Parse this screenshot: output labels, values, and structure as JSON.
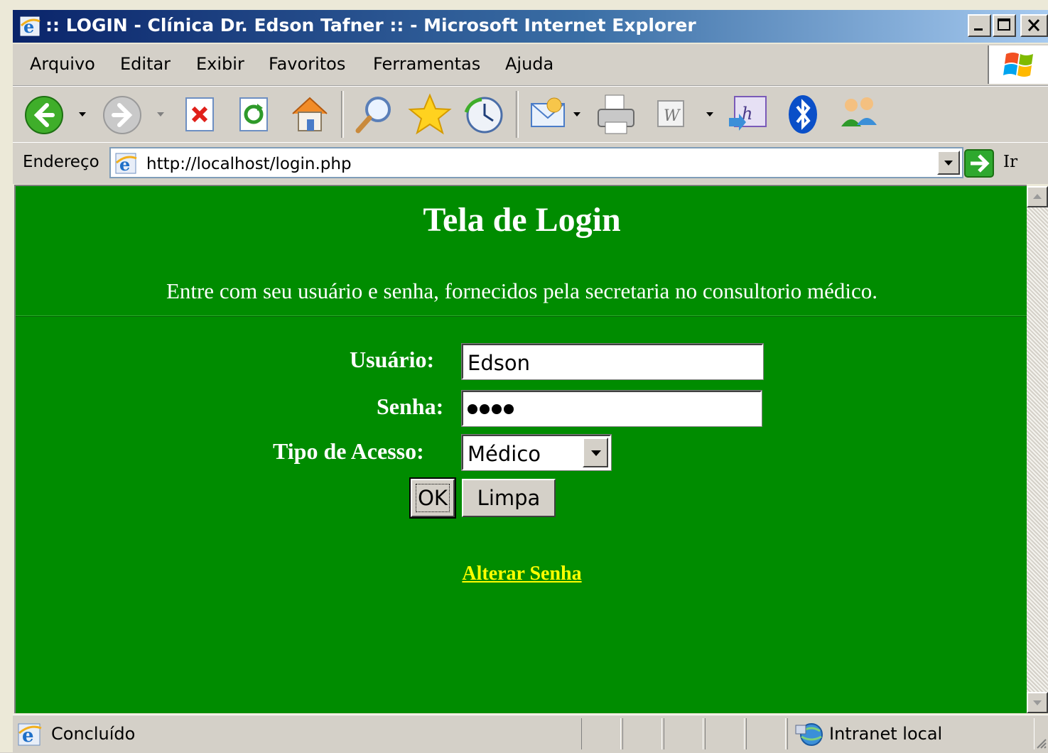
{
  "window": {
    "title": ":: LOGIN - Clínica Dr. Edson Tafner :: - Microsoft Internet Explorer"
  },
  "menu": {
    "items": [
      "Arquivo",
      "Editar",
      "Exibir",
      "Favoritos",
      "Ferramentas",
      "Ajuda"
    ]
  },
  "toolbar": {
    "buttons": [
      "back-icon",
      "forward-icon",
      "stop-icon",
      "refresh-icon",
      "home-icon",
      "search-icon",
      "favorites-icon",
      "history-icon",
      "mail-icon",
      "print-icon",
      "edit-icon",
      "messenger-icon",
      "bluetooth-icon",
      "contacts-icon"
    ]
  },
  "address": {
    "label": "Endereço",
    "url": "http://localhost/login.php",
    "go_label": "Ir"
  },
  "page": {
    "title": "Tela de Login",
    "intro": "Entre com seu usuário e senha, fornecidos pela secretaria no consultorio médico.",
    "user_label": "Usuário:",
    "user_value": "Edson",
    "password_label": "Senha:",
    "password_length": 4,
    "access_label": "Tipo de Acesso:",
    "access_value": "Médico",
    "ok_label": "OK",
    "clear_label": "Limpa",
    "change_password_link": "Alterar Senha"
  },
  "status": {
    "text": "Concluído",
    "zone": "Intranet local"
  },
  "colors": {
    "page_background": "#008c00",
    "link": "#ffff00",
    "titlebar": "#0a246a"
  }
}
